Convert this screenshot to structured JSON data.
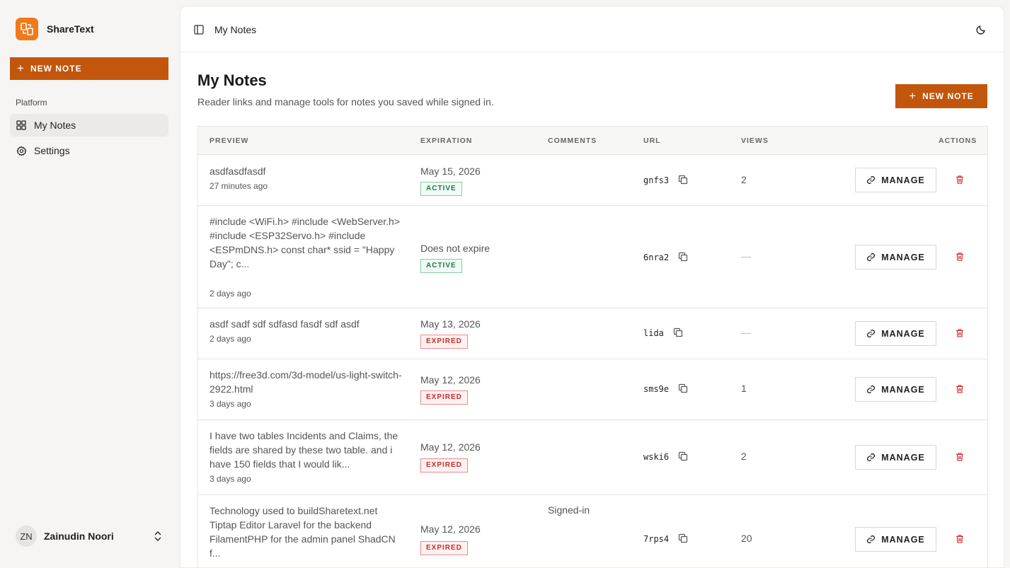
{
  "app": {
    "name": "ShareText"
  },
  "sidebar": {
    "new_note_label": "NEW NOTE",
    "section_label": "Platform",
    "items": [
      {
        "label": "My Notes",
        "icon": "grid-icon",
        "active": true
      },
      {
        "label": "Settings",
        "icon": "gear-icon",
        "active": false
      }
    ],
    "user": {
      "initials": "ZN",
      "name": "Zainudin Noori"
    }
  },
  "header": {
    "breadcrumb": "My Notes"
  },
  "page": {
    "title": "My Notes",
    "subtitle": "Reader links and manage tools for notes you saved while signed in.",
    "new_note_label": "NEW NOTE"
  },
  "table": {
    "columns": [
      "PREVIEW",
      "EXPIRATION",
      "COMMENTS",
      "URL",
      "VIEWS",
      "ACTIONS"
    ],
    "manage_label": "MANAGE",
    "rows": [
      {
        "preview": "asdfasdfasdf",
        "ago": "27 minutes ago",
        "expiration": "May 15, 2026",
        "status": "ACTIVE",
        "comments": "",
        "url": "gnfs3",
        "views": "2"
      },
      {
        "preview": "#include <WiFi.h> #include <WebServer.h> #include <ESP32Servo.h> #include <ESPmDNS.h> const char* ssid = \"Happy Day\"; c...",
        "ago": "2 days ago",
        "expiration": "Does not expire",
        "status": "ACTIVE",
        "comments": "",
        "url": "6nra2",
        "views": "—"
      },
      {
        "preview": "asdf sadf sdf sdfasd fasdf sdf asdf",
        "ago": "2 days ago",
        "expiration": "May 13, 2026",
        "status": "EXPIRED",
        "comments": "",
        "url": "lida",
        "views": "—"
      },
      {
        "preview": "https://free3d.com/3d-model/us-light-switch-2922.html",
        "ago": "3 days ago",
        "expiration": "May 12, 2026",
        "status": "EXPIRED",
        "comments": "",
        "url": "sms9e",
        "views": "1"
      },
      {
        "preview": "I have two tables Incidents and Claims, the fields are shared by these two table. and i have 150 fields that I would lik...",
        "ago": "3 days ago",
        "expiration": "May 12, 2026",
        "status": "EXPIRED",
        "comments": "",
        "url": "wski6",
        "views": "2"
      },
      {
        "preview": "Technology used to buildSharetext.net Tiptap Editor Laravel for the backend FilamentPHP for the admin panel ShadCN f...",
        "ago": "",
        "expiration": "May 12, 2026",
        "status": "EXPIRED",
        "comments": "Signed-in",
        "url": "7rps4",
        "views": "20"
      }
    ]
  },
  "colors": {
    "accent": "#c2560c",
    "brand_logo": "#f07a1a",
    "active": "#1e7a45",
    "expired": "#c62d2d"
  }
}
